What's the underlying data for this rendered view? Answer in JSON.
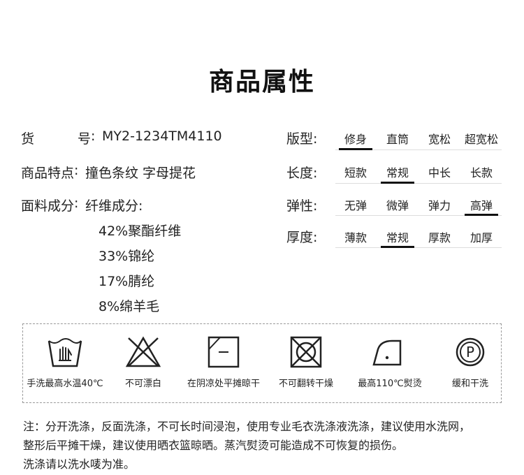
{
  "title": "商品属性",
  "attributes": {
    "sku": {
      "label": [
        "货",
        "号"
      ],
      "colon": ":",
      "value": "MY2-1234TM4110"
    },
    "features": {
      "label": "商品特点",
      "colon": ":",
      "value": "撞色条纹 字母提花"
    },
    "material": {
      "label": "面料成分",
      "colon": ":",
      "value": "纤维成分:"
    },
    "fibers": [
      "42%聚酯纤维",
      "33%锦纶",
      "17%腈纶",
      "8%绵羊毛"
    ]
  },
  "specs": [
    {
      "label": "版型:",
      "options": [
        "修身",
        "直筒",
        "宽松",
        "超宽松"
      ],
      "selected": 0
    },
    {
      "label": "长度:",
      "options": [
        "短款",
        "常规",
        "中长",
        "长款"
      ],
      "selected": 1
    },
    {
      "label": "弹性:",
      "options": [
        "无弹",
        "微弹",
        "弹力",
        "高弹"
      ],
      "selected": 3
    },
    {
      "label": "厚度:",
      "options": [
        "薄款",
        "常规",
        "厚款",
        "加厚"
      ],
      "selected": 1
    }
  ],
  "care": [
    {
      "icon": "hand-wash-40-icon",
      "label": "手洗最高水温40℃"
    },
    {
      "icon": "no-bleach-icon",
      "label": "不可漂白"
    },
    {
      "icon": "shade-dry-flat-icon",
      "label": "在阴凉处平摊晾干"
    },
    {
      "icon": "no-tumble-dry-icon",
      "label": "不可翻转干燥"
    },
    {
      "icon": "iron-110-icon",
      "label": "最高110℃熨烫"
    },
    {
      "icon": "dry-clean-p-icon",
      "label": "缓和干洗"
    }
  ],
  "notes": [
    "注：分开洗涤，反面洗涤，不可长时间浸泡，使用专业毛衣洗涤液洗涤，建议使用水洗网，",
    "整形后平摊干燥，建议使用晒衣篮晾晒。蒸汽熨烫可能造成不可恢复的损伤。",
    "洗涤请以洗水唛为准。"
  ]
}
